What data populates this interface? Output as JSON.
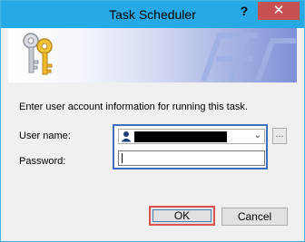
{
  "window": {
    "title": "Task Scheduler",
    "help_glyph": "?",
    "close_glyph": "✕"
  },
  "banner": {
    "icon": "keys-icon"
  },
  "form": {
    "prompt": "Enter user account information for running this task.",
    "user_label": "User name:",
    "password_label": "Password:",
    "user_value_redacted": true,
    "browse_label": "...",
    "password_value": ""
  },
  "buttons": {
    "ok": "OK",
    "cancel": "Cancel"
  },
  "colors": {
    "titlebar": "#27a9e6",
    "close": "#c75050",
    "focus": "#3f6fba",
    "highlight": "#d9534f"
  }
}
